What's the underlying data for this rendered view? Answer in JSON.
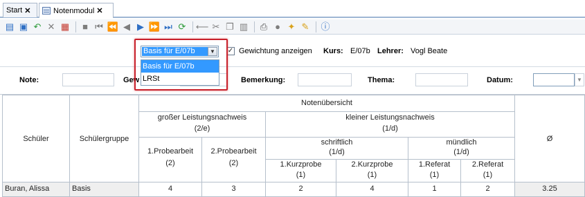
{
  "tabs": [
    {
      "label": "Start",
      "close": "✕"
    },
    {
      "label": "Notenmodul",
      "close": "✕"
    }
  ],
  "toolbar": {
    "icons": [
      "new-icon",
      "save-icon",
      "undo-icon",
      "delete-icon",
      "print-preview-icon",
      "stop-icon",
      "first-icon",
      "prev-page-icon",
      "prev-icon",
      "next-icon",
      "next-page-icon",
      "last-icon",
      "refresh-icon",
      "back-icon",
      "cut-icon",
      "copy-icon",
      "paste-icon",
      "print-icon",
      "view-icon",
      "bulb-icon",
      "clean-icon",
      "help-icon"
    ]
  },
  "filter": {
    "basis_selected": "Basis für E/07b",
    "options": [
      "Basis für E/07b",
      "LRSt"
    ],
    "gewichtung_label": "Gewichtung anzeigen",
    "gewichtung_checked": true,
    "kurs_label": "Kurs:",
    "kurs_value": "E/07b",
    "lehrer_label": "Lehrer:",
    "lehrer_value": "Vogl Beate"
  },
  "filter2": {
    "note_label": "Note:",
    "gew_label": "Gew",
    "bemerkung_label": "Bemerkung:",
    "thema_label": "Thema:",
    "datum_label": "Datum:"
  },
  "grid": {
    "col_schueler": "Schüler",
    "col_gruppe": "Schülergruppe",
    "notenuebersicht": "Notenübersicht",
    "gross_title": "großer Leistungsnachweis",
    "gross_weight": "(2/e)",
    "klein_title": "kleiner Leistungsnachweis",
    "klein_weight": "(1/d)",
    "schriftlich_title": "schriftlich",
    "schriftlich_weight": "(1/d)",
    "muendlich_title": "mündlich",
    "muendlich_weight": "(1/d)",
    "pa1_title": "1.Probearbeit",
    "pa1_weight": "(2)",
    "pa2_title": "2.Probearbeit",
    "pa2_weight": "(2)",
    "kp1_title": "1.Kurzprobe",
    "kp1_weight": "(1)",
    "kp2_title": "2.Kurzprobe",
    "kp2_weight": "(1)",
    "ref1_title": "1.Referat",
    "ref1_weight": "(1)",
    "ref2_title": "2.Referat",
    "ref2_weight": "(1)",
    "avg_header": "Ø",
    "rows": [
      {
        "name": "Buran, Alissa",
        "gruppe": "Basis",
        "pa1": "4",
        "pa2": "3",
        "kp1": "2",
        "kp2": "4",
        "ref1": "1",
        "ref2": "2",
        "avg": "3.25"
      }
    ]
  }
}
